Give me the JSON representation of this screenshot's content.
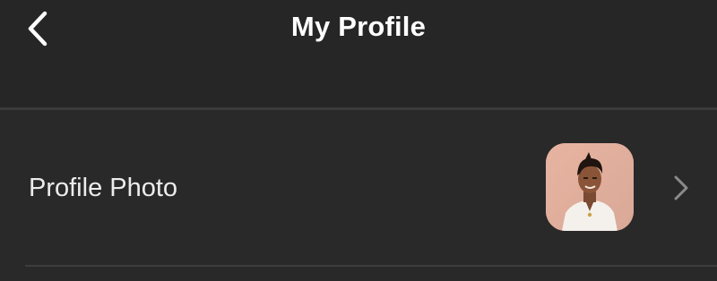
{
  "header": {
    "title": "My Profile",
    "back_icon": "back-chevron-icon"
  },
  "profile_photo_row": {
    "label": "Profile Photo",
    "avatar": "avatar",
    "chevron_icon": "chevron-right-icon"
  },
  "colors": {
    "background": "#292929",
    "header_background": "#262626",
    "divider": "#3b3b3b",
    "text": "#ffffff",
    "chevron": "#8a8a8a"
  }
}
